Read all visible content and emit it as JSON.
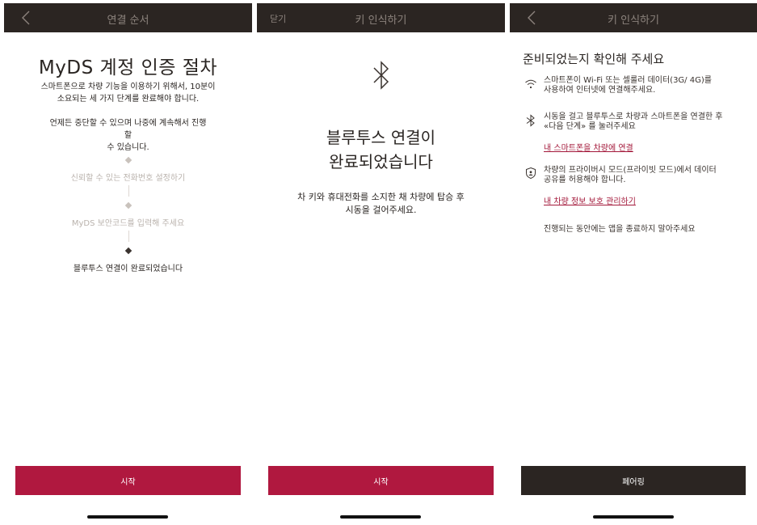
{
  "colors": {
    "header_bg": "#2b2522",
    "accent_red": "#b0183f",
    "link": "#a3183a",
    "dark_button": "#2b2522"
  },
  "panel1": {
    "header_title": "연결 순서",
    "title": "MyDS 계정 인증 절차",
    "desc_line1": "스마트폰으로 차량 기능을 이용하기 위해서, 10분이",
    "desc_line2": "소요되는 세 가지 단계를 완료해야 합니다.",
    "desc2_line1": "언제든 중단할 수 있으며 나중에 계속해서 진행할",
    "desc2_line2": "수 있습니다.",
    "steps": [
      {
        "label": "신뢰할 수 있는 전화번호 설정하기",
        "status": "done"
      },
      {
        "label": "MyDS 보안코드를 입력해 주세요",
        "status": "done"
      },
      {
        "label": "블루투스 연결이 완료되었습니다",
        "status": "current"
      }
    ],
    "button_label": "시작"
  },
  "panel2": {
    "close_label": "닫기",
    "header_title": "키 인식하기",
    "title_line1": "블루투스 연결이",
    "title_line2": "완료되었습니다",
    "desc_line1": "차 키와 휴대전화를 소지한 채 차량에 탑승 후",
    "desc_line2": "시동을 걸어주세요.",
    "button_label": "시작"
  },
  "panel3": {
    "header_title": "키 인식하기",
    "title": "준비되었는지 확인해 주세요",
    "item1_line1": "스마트폰이 Wi-Fi 또는 셀룰러 데이터(3G/ 4G)를",
    "item1_line2": "사용하여 인터넷에 연결해주세요.",
    "item2_line1": "시동을 걸고 블루투스로 차량과 스마트폰을 연결한 후",
    "item2_line2": "«다음 단계» 를 눌러주세요",
    "item2_link": "내 스마트폰을 차량에 연결",
    "item3_line1": "차량의 프라이버시 모드(프라이빗 모드)에서 데이터",
    "item3_line2": "공유를 허용해야 합니다.",
    "item3_link": "내 차량 정보 보호 관리하기",
    "note": "진행되는 동안에는 앱을 종료하지 말아주세요",
    "button_label": "페어링"
  }
}
